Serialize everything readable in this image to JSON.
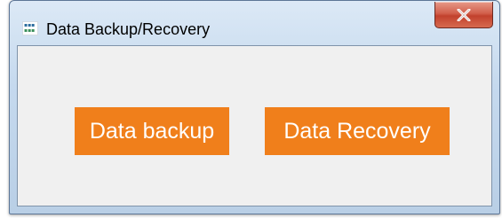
{
  "window": {
    "title": "Data Backup/Recovery",
    "icon": "app-icon",
    "close_icon": "close-icon"
  },
  "buttons": {
    "backup_label": "Data backup",
    "recovery_label": "Data Recovery"
  },
  "colors": {
    "button_bg": "#f07f1b",
    "button_text": "#ffffff",
    "client_bg": "#f0f0f0",
    "close_button": "#c2412d"
  }
}
